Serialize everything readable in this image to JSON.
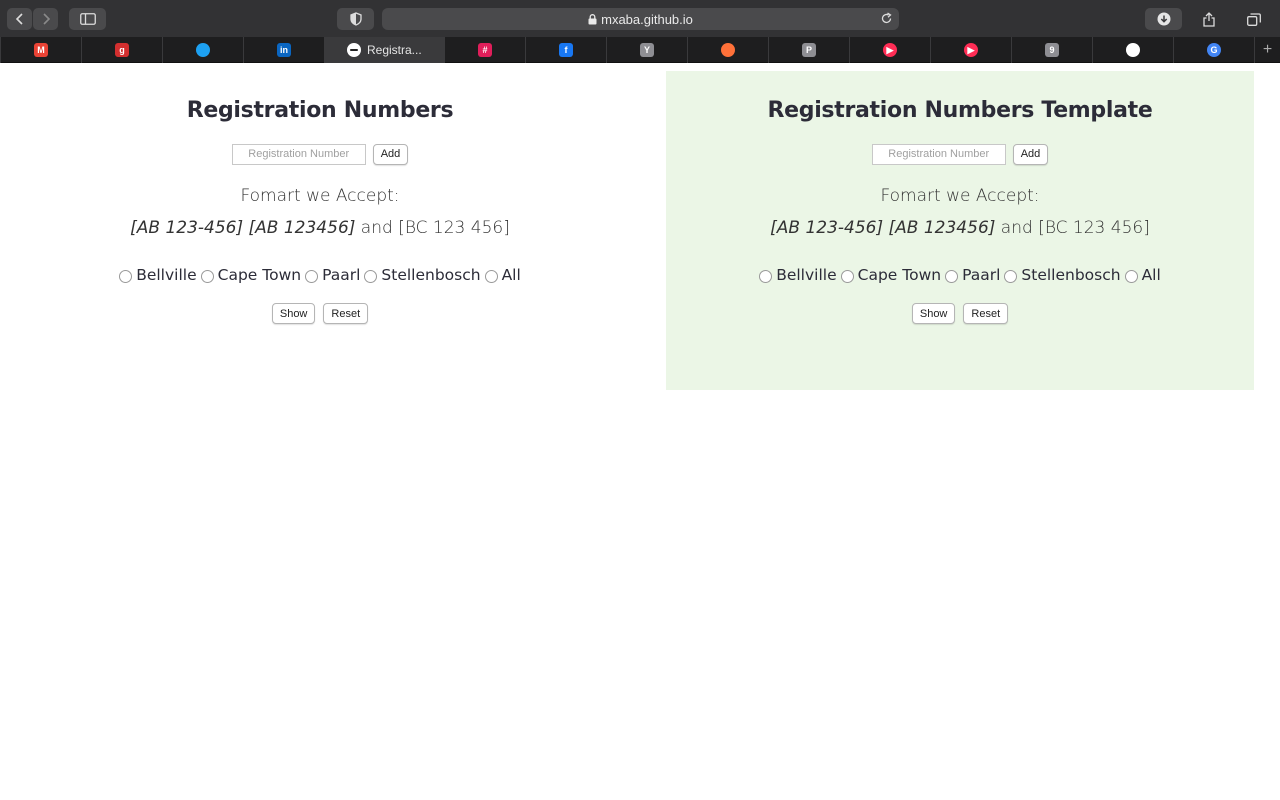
{
  "browser": {
    "url": "mxaba.github.io",
    "active_tab_label": "Registra...",
    "tabs": [
      {
        "name": "gmail",
        "letter": "M",
        "color": "#ea4335"
      },
      {
        "name": "gumtree",
        "letter": "g",
        "color": "#d32f2f"
      },
      {
        "name": "twitter",
        "letter": "",
        "color": "#1da1f2"
      },
      {
        "name": "linkedin",
        "letter": "in",
        "color": "#0a66c2"
      },
      {
        "name": "registration",
        "letter": "",
        "color": "#ffffff"
      },
      {
        "name": "slack",
        "letter": "#",
        "color": "#e01e5a"
      },
      {
        "name": "facebook",
        "letter": "f",
        "color": "#1877f2"
      },
      {
        "name": "y",
        "letter": "Y",
        "color": "#8e8e93"
      },
      {
        "name": "firefox",
        "letter": "",
        "color": "#ff7139"
      },
      {
        "name": "p",
        "letter": "P",
        "color": "#8e8e93"
      },
      {
        "name": "music-1",
        "letter": "▶",
        "color": "#ff2d55"
      },
      {
        "name": "music-2",
        "letter": "▶",
        "color": "#ff2d55"
      },
      {
        "name": "nine",
        "letter": "9",
        "color": "#8e8e93"
      },
      {
        "name": "github",
        "letter": "",
        "color": "#ffffff"
      },
      {
        "name": "google",
        "letter": "G",
        "color": "#4285f4"
      }
    ]
  },
  "left": {
    "title": "Registration Numbers",
    "input_placeholder": "Registration Number",
    "add_label": "Add",
    "format_heading": "Fomart we Accept:",
    "format_italic": "[AB 123-456] [AB 123456]",
    "format_and": " and ",
    "format_plain": "[BC 123 456]",
    "towns": [
      "Bellville",
      "Cape Town",
      "Paarl",
      "Stellenbosch",
      "All"
    ],
    "show_label": "Show",
    "reset_label": "Reset"
  },
  "right": {
    "title": "Registration Numbers Template",
    "input_placeholder": "Registration Number",
    "add_label": "Add",
    "format_heading": "Fomart we Accept:",
    "format_italic": "[AB 123-456] [AB 123456]",
    "format_and": " and ",
    "format_plain": "[BC 123 456]",
    "towns": [
      "Bellville",
      "Cape Town",
      "Paarl",
      "Stellenbosch",
      "All"
    ],
    "show_label": "Show",
    "reset_label": "Reset"
  }
}
